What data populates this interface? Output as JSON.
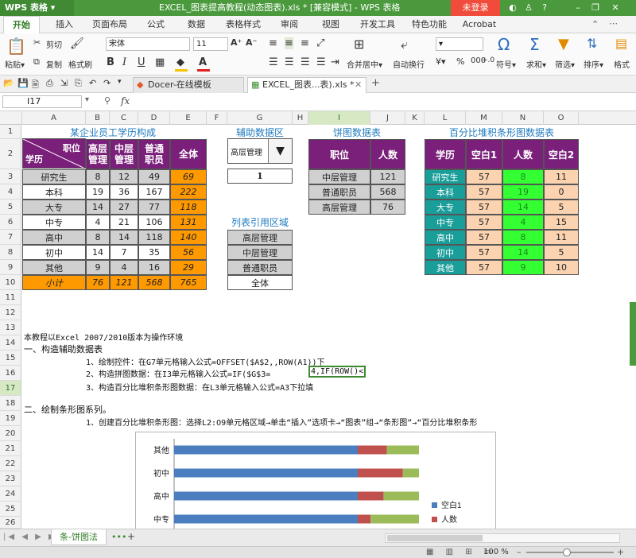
{
  "app": {
    "logo": "WPS 表格",
    "title": "EXCEL_图表提高教程(动态图表).xls * [兼容模式] - WPS 表格",
    "login": "未登录"
  },
  "window_controls": {
    "icons": [
      "skin-icon",
      "shirt-icon",
      "help-icon",
      "minimize-icon",
      "restore-icon",
      "close-icon"
    ]
  },
  "menu": [
    "开始",
    "插入",
    "页面布局",
    "公式",
    "数据",
    "表格样式",
    "审阅",
    "视图",
    "开发工具",
    "特色功能",
    "Acrobat"
  ],
  "ribbon": {
    "cut": "剪切",
    "copy": "复制",
    "format_painter": "格式刷",
    "paste": "粘贴",
    "font_name": "宋体",
    "font_size": "11",
    "merge_center": "合并居中",
    "auto_wrap": "自动换行",
    "symbol": "符号",
    "sum": "求和",
    "filter": "筛选",
    "sort": "排序",
    "format": "格式"
  },
  "tabs": [
    {
      "label": "Docer-在线模板"
    },
    {
      "label": "EXCEL_图表...表).xls *"
    }
  ],
  "formula_bar": {
    "cell_ref": "I17",
    "fx": "fx"
  },
  "columns": [
    "A",
    "B",
    "C",
    "D",
    "E",
    "F",
    "G",
    "H",
    "I",
    "J",
    "K",
    "L",
    "M",
    "N",
    "O"
  ],
  "rows": [
    "1",
    "2",
    "3",
    "4",
    "5",
    "6",
    "7",
    "8",
    "9",
    "10",
    "11",
    "12",
    "13",
    "14",
    "15",
    "16",
    "17",
    "18",
    "19",
    "20",
    "21",
    "22",
    "23",
    "24",
    "25",
    "26"
  ],
  "table1": {
    "title": "某企业员工学历构成",
    "hdr_pos": "职位",
    "hdr_edu": "学历",
    "cols": [
      "高层\n管理",
      "中层\n管理",
      "普通\n职员",
      "全体"
    ],
    "rows": [
      [
        "研究生",
        "8",
        "12",
        "49",
        "69"
      ],
      [
        "本科",
        "19",
        "36",
        "167",
        "222"
      ],
      [
        "大专",
        "14",
        "27",
        "77",
        "118"
      ],
      [
        "中专",
        "4",
        "21",
        "106",
        "131"
      ],
      [
        "高中",
        "8",
        "14",
        "118",
        "140"
      ],
      [
        "初中",
        "14",
        "7",
        "35",
        "56"
      ],
      [
        "其他",
        "9",
        "4",
        "16",
        "29"
      ]
    ],
    "total": [
      "小计",
      "76",
      "121",
      "568",
      "765"
    ]
  },
  "helper": {
    "title": "辅助数据区",
    "dropdown_value": "高层管理",
    "index_value": "1",
    "list_title": "列表引用区域",
    "list": [
      "高层管理",
      "中层管理",
      "普通职员",
      "全体"
    ]
  },
  "pie_table": {
    "title": "饼图数据表",
    "headers": [
      "职位",
      "人数"
    ],
    "rows": [
      [
        "中层管理",
        "121"
      ],
      [
        "普通职员",
        "568"
      ],
      [
        "高层管理",
        "76"
      ]
    ]
  },
  "bar_table": {
    "title": "百分比堆积条形图数据表",
    "headers": [
      "学历",
      "空白1",
      "人数",
      "空白2"
    ],
    "rows": [
      [
        "研究生",
        "57",
        "8",
        "11"
      ],
      [
        "本科",
        "57",
        "19",
        "0"
      ],
      [
        "大专",
        "57",
        "14",
        "5"
      ],
      [
        "中专",
        "57",
        "4",
        "15"
      ],
      [
        "高中",
        "57",
        "8",
        "11"
      ],
      [
        "初中",
        "57",
        "14",
        "5"
      ],
      [
        "其他",
        "57",
        "9",
        "10"
      ]
    ]
  },
  "instructions": {
    "line14": "本教程以Excel 2007/2010版本为操作环境",
    "line15": "一、构造辅助数据表",
    "line16": "1、绘制控件：在G7单元格输入公式=OFFSET($A$2,,ROW(A1))下",
    "line17a": "2、构造拼图数据：在I3单元格输入公式=IF($G$3=",
    "line17b": "4,IF(ROW()<",
    "line18": "3、构造百分比堆积条形图数据：在L3单元格输入公式=A3下拉填",
    "line20": "二、绘制条形图系列。",
    "line21": "1、创建百分比堆积条形图：选择L2:O9单元格区域→单击“插入”选项卡→“图表”组→“条形图”→“百分比堆积条形"
  },
  "chart_data": {
    "type": "bar",
    "orientation": "horizontal",
    "stacked": "percent",
    "categories": [
      "其他",
      "初中",
      "高中",
      "中专"
    ],
    "series": [
      {
        "name": "空白1",
        "values": [
          57,
          57,
          57,
          57
        ]
      },
      {
        "name": "人数",
        "values": [
          9,
          14,
          8,
          4
        ]
      },
      {
        "name": "",
        "values": [
          10,
          5,
          11,
          15
        ]
      }
    ],
    "colors": [
      "#4a7ebf",
      "#c0504d",
      "#9bbb59"
    ],
    "legend": "right"
  },
  "sheet_tab": "条-饼图法",
  "status": {
    "zoom": "100 %"
  }
}
